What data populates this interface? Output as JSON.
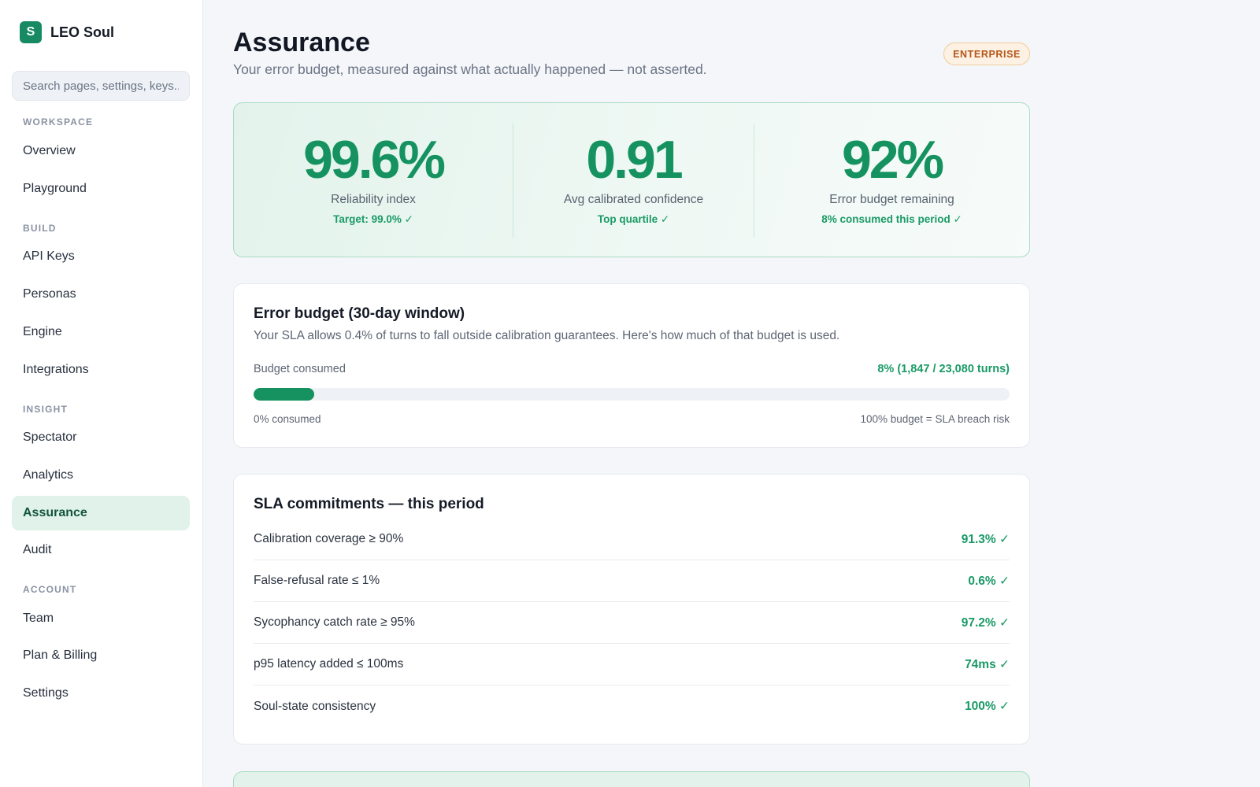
{
  "app": {
    "logo_letter": "S",
    "name": "LEO Soul"
  },
  "search": {
    "placeholder": "Search pages, settings, keys..."
  },
  "sidebar": {
    "sections": [
      {
        "title": "WORKSPACE"
      },
      {
        "title": "BUILD"
      },
      {
        "title": "INSIGHT"
      },
      {
        "title": "ACCOUNT"
      }
    ],
    "items": [
      {
        "label": "Overview"
      },
      {
        "label": "Playground"
      },
      {
        "label": "API Keys"
      },
      {
        "label": "Personas"
      },
      {
        "label": "Engine"
      },
      {
        "label": "Integrations"
      },
      {
        "label": "Spectator"
      },
      {
        "label": "Analytics"
      },
      {
        "label": "Assurance",
        "active": true
      },
      {
        "label": "Audit"
      },
      {
        "label": "Team"
      },
      {
        "label": "Plan & Billing"
      },
      {
        "label": "Settings"
      }
    ]
  },
  "header": {
    "title": "Assurance",
    "subtitle": "Your error budget, measured against what actually happened — not asserted.",
    "badge": "ENTERPRISE"
  },
  "metrics": [
    {
      "value": "99.6%",
      "label": "Reliability index",
      "note": "Target: 99.0% ✓"
    },
    {
      "value": "0.91",
      "label": "Avg calibrated confidence",
      "note": "Top quartile ✓"
    },
    {
      "value": "92%",
      "label": "Error budget remaining",
      "note": "8% consumed this period ✓"
    }
  ],
  "budget": {
    "title": "Error budget (30-day window)",
    "description": "Your SLA allows 0.4% of turns to fall outside calibration guarantees. Here's how much of that budget is used.",
    "bar_label": "Budget consumed",
    "bar_value": "8% (1,847 / 23,080 turns)",
    "consumed_fraction": 0.08,
    "min_label": "0% consumed",
    "max_label": "100% budget = SLA breach risk"
  },
  "sla": {
    "title": "SLA commitments — this period",
    "rows": [
      {
        "name": "Calibration coverage ≥ 90%",
        "value": "91.3% ✓"
      },
      {
        "name": "False-refusal rate ≤ 1%",
        "value": "0.6% ✓"
      },
      {
        "name": "Sycophancy catch rate ≥ 95%",
        "value": "97.2% ✓"
      },
      {
        "name": "p95 latency added ≤ 100ms",
        "value": "74ms ✓"
      },
      {
        "name": "Soul-state consistency",
        "value": "100% ✓"
      }
    ]
  },
  "colors": {
    "accent": "#15925f",
    "active_nav_bg": "#e0f2ea",
    "badge_text": "#b5561a",
    "badge_bg": "#fcf1e2"
  }
}
